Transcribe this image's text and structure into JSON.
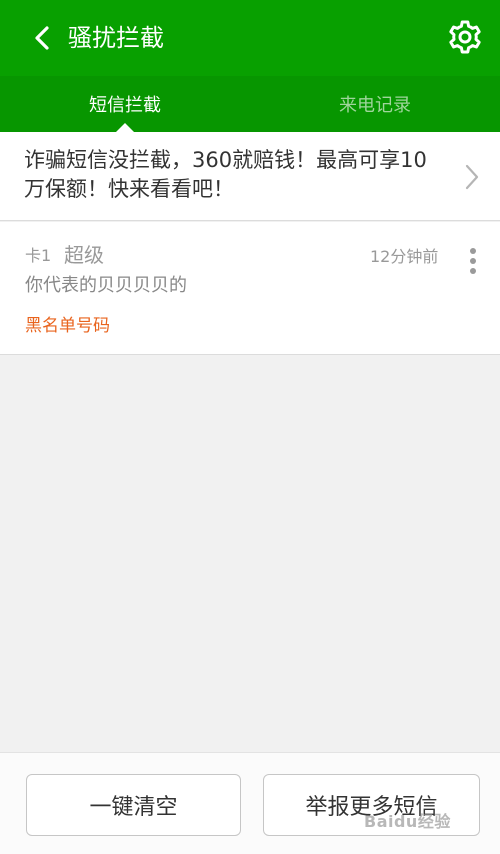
{
  "header": {
    "title": "骚扰拦截",
    "back_icon": "chevron-left-icon",
    "settings_icon": "gear-icon"
  },
  "tabs": [
    {
      "label": "短信拦截",
      "active": true
    },
    {
      "label": "来电记录",
      "active": false
    }
  ],
  "banner": {
    "text": "诈骗短信没拦截，360就赔钱！最高可享10万保额！快来看看吧！",
    "icon": "chevron-right-icon"
  },
  "messages": [
    {
      "card": "卡1",
      "sender": "超级",
      "time": "12分钟前",
      "body": "你代表的贝贝贝贝的",
      "tag": "黑名单号码"
    }
  ],
  "actions": {
    "clear_label": "一键清空",
    "report_label": "举报更多短信"
  },
  "watermark": "Baidu经验",
  "colors": {
    "header": "#08a000",
    "tabs": "#079600",
    "tag": "#e9641e"
  }
}
